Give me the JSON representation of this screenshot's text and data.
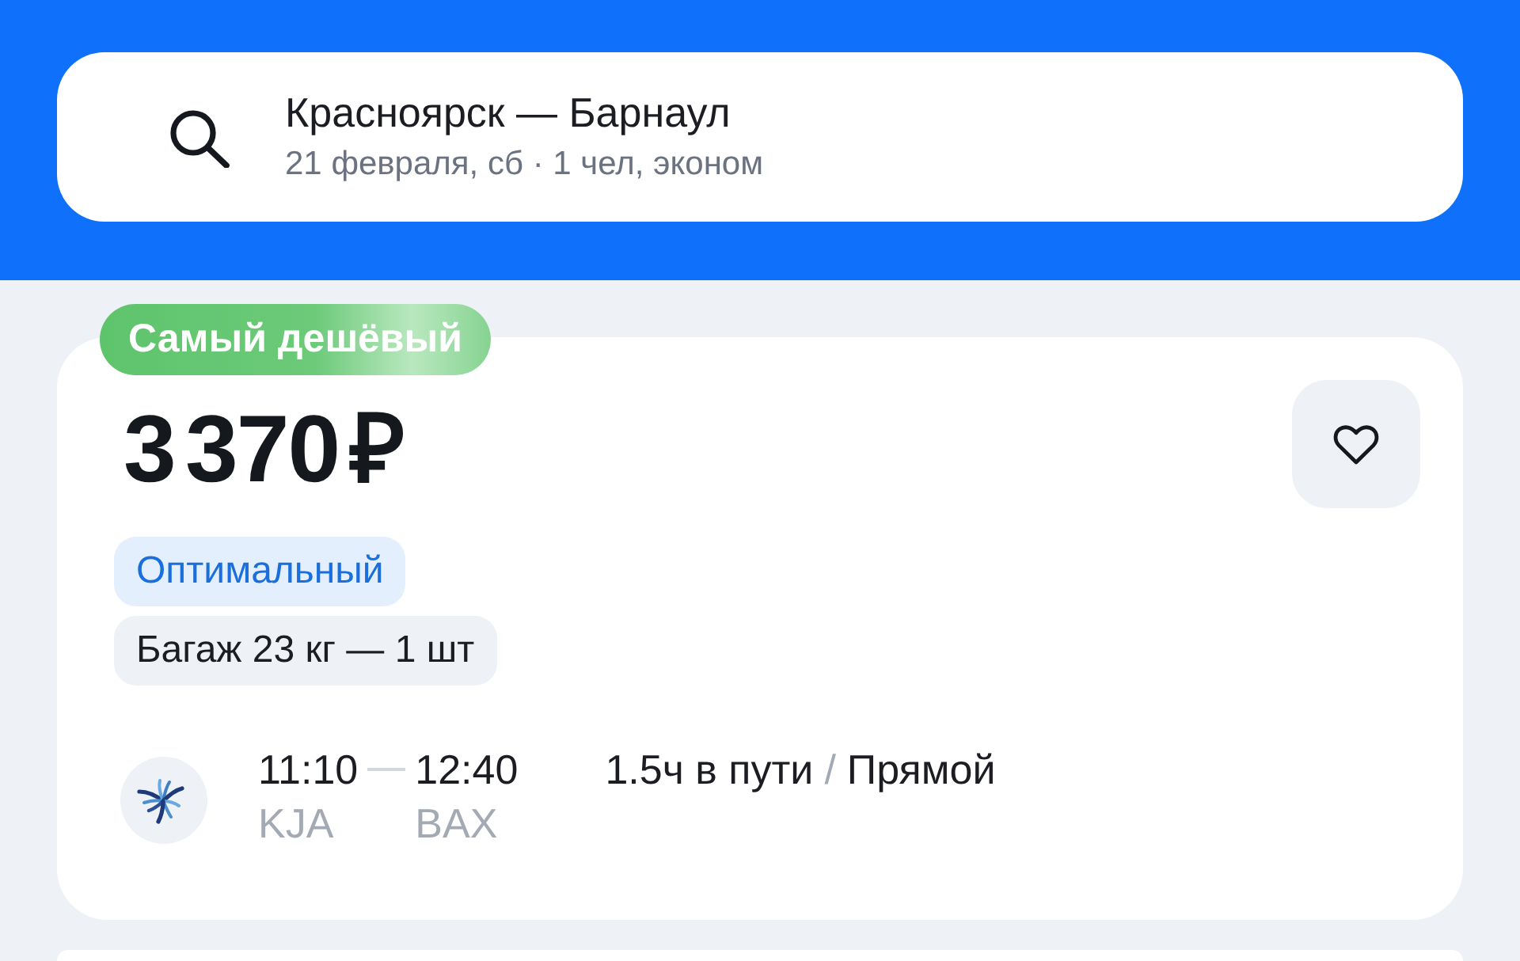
{
  "search": {
    "route": "Красноярск — Барнаул",
    "details": "21 февраля, сб · 1 чел, эконом"
  },
  "results": [
    {
      "badge": "Самый дешёвый",
      "price": "3 370 ₽",
      "favorite": false,
      "tags": [
        {
          "text": "Оптимальный",
          "kind": "fare"
        },
        {
          "text": "Багаж 23 кг — 1 шт",
          "kind": "baggage"
        }
      ],
      "flight": {
        "departure_time": "11:10",
        "arrival_time": "12:40",
        "departure_airport": "KJA",
        "arrival_airport": "BAX",
        "duration": "1.5ч в пути",
        "separator": "/",
        "stops": "Прямой"
      }
    }
  ]
}
